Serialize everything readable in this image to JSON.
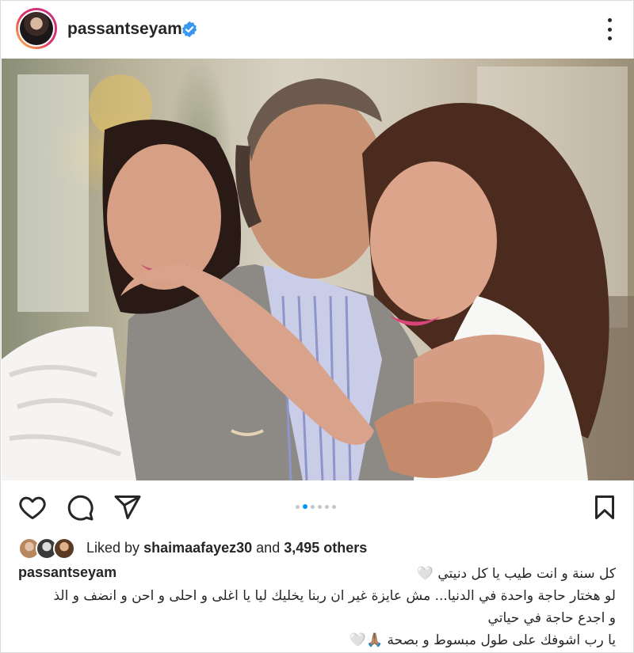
{
  "header": {
    "username": "passantseyam"
  },
  "actions": {
    "carousel_dots": 6,
    "carousel_active_index": 1
  },
  "likes": {
    "prefix": "Liked by",
    "first_liker": "shaimaafayez30",
    "conjunction": "and",
    "others": "3,495 others"
  },
  "caption": {
    "username": "passantseyam",
    "lines": [
      "كل سنة و انت طيب يا كل دنيتي 🤍",
      "لو هختار حاجة واحدة في الدنيا... مش عايزة غير ان ربنا يخليك ليا يا اغلى و احلى و احن و انضف و الذ",
      "و اجدع حاجة في حياتي",
      "يا رب اشوفك على طول مبسوط و بصحة 🙏🏽🤍"
    ]
  },
  "colors": {
    "verified": "#3897f0",
    "active_dot": "#0095f6",
    "text": "#262626"
  }
}
